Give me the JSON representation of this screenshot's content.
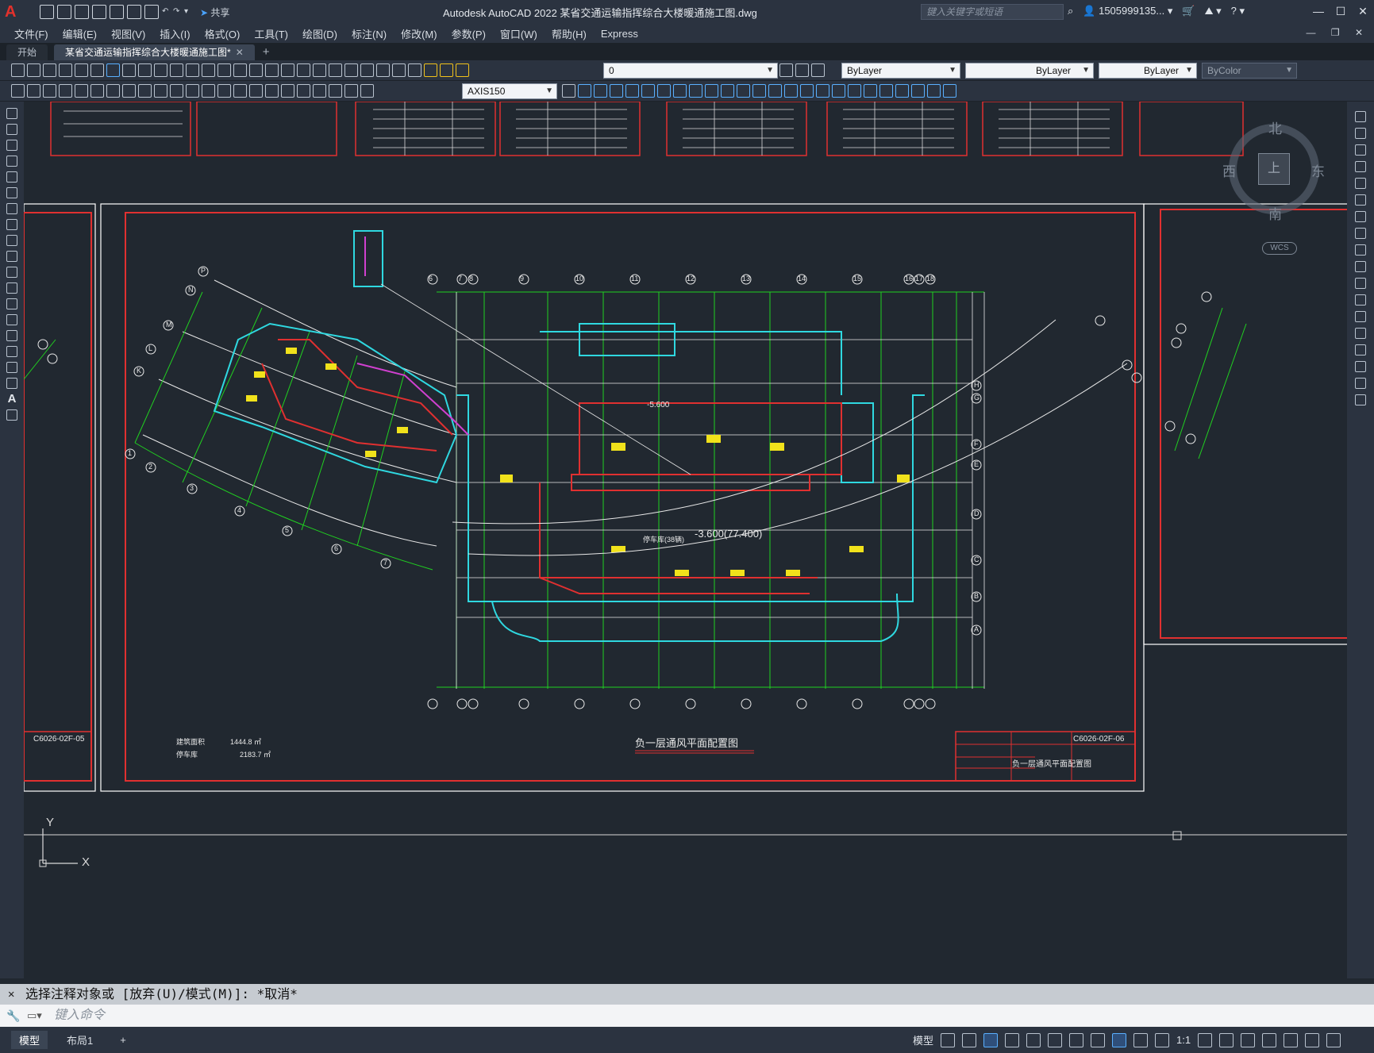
{
  "app": {
    "title": "Autodesk AutoCAD 2022    某省交通运输指挥综合大楼暖通施工图.dwg",
    "search_placeholder": "键入关键字或短语",
    "user": "1505999135...",
    "share": "共享"
  },
  "menu": [
    "文件(F)",
    "编辑(E)",
    "视图(V)",
    "插入(I)",
    "格式(O)",
    "工具(T)",
    "绘图(D)",
    "标注(N)",
    "修改(M)",
    "参数(P)",
    "窗口(W)",
    "帮助(H)",
    "Express"
  ],
  "tabs": {
    "start": "开始",
    "doc": "某省交通运输指挥综合大楼暖通施工图*"
  },
  "toolbar": {
    "layer": "0",
    "color": "ByLayer",
    "linetype": "ByLayer",
    "lineweight": "ByLayer",
    "plotstyle": "ByColor",
    "dimstyle": "AXIS150"
  },
  "compass": {
    "north": "北",
    "south": "南",
    "east": "东",
    "west": "西",
    "top": "上",
    "wcs": "WCS"
  },
  "drawing": {
    "title": "负一层通风平面配置图",
    "sheet_right": "C6026-02F-06",
    "sheet_left": "C6026-02F-05",
    "elevation_main": "-3.600(77.400)",
    "elevation_small": "-5.600",
    "garage_label": "停车库(38辆)",
    "area_label_1": "建筑面积",
    "area_value_1": "1444.8 ㎡",
    "area_label_2": "停车库",
    "area_value_2": "2183.7 ㎡",
    "axes_top": [
      "6",
      "7",
      "8",
      "9",
      "10",
      "11",
      "12",
      "13",
      "14",
      "15",
      "16",
      "17",
      "18"
    ],
    "axes_right": [
      "H",
      "G",
      "F",
      "E",
      "D",
      "C",
      "B",
      "A"
    ],
    "axes_arc": [
      "1",
      "2",
      "3",
      "4",
      "5",
      "6",
      "7"
    ],
    "axes_arc_letters": [
      "P",
      "N",
      "M",
      "L",
      "K"
    ]
  },
  "command": {
    "history": "选择注释对象或 [放弃(U)/模式(M)]: *取消*",
    "placeholder": "键入命令"
  },
  "status": {
    "model_tab": "模型",
    "layout_tab": "布局1",
    "model_btn": "模型",
    "scale": "1:1"
  },
  "ucs": {
    "x": "X",
    "y": "Y"
  }
}
